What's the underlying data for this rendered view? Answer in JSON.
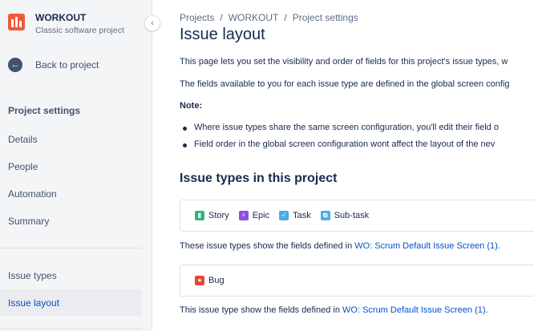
{
  "project": {
    "name": "WORKOUT",
    "type": "Classic software project",
    "logo_color": "#ef5a3a"
  },
  "sidebar": {
    "back_label": "Back to project",
    "section_title": "Project settings",
    "items": [
      {
        "label": "Details"
      },
      {
        "label": "People"
      },
      {
        "label": "Automation"
      },
      {
        "label": "Summary"
      }
    ],
    "items_lower": [
      {
        "label": "Issue types"
      },
      {
        "label": "Issue layout"
      }
    ]
  },
  "breadcrumb": [
    "Projects",
    "WORKOUT",
    "Project settings"
  ],
  "page": {
    "title": "Issue layout",
    "intro1": "This page lets you set the visibility and order of fields for this project's issue types, w",
    "intro2": "The fields available to you for each issue type are defined in the global screen config",
    "note_label": "Note:",
    "bullets": [
      "Where issue types share the same screen configuration, you'll edit their field o",
      "Field order in the global screen configuration wont affect the layout of the nev"
    ],
    "section_title": "Issue types in this project"
  },
  "groups": [
    {
      "types": [
        {
          "name": "Story",
          "icon": "story-icon",
          "color": "#36b37e"
        },
        {
          "name": "Epic",
          "icon": "epic-icon",
          "color": "#904ee2"
        },
        {
          "name": "Task",
          "icon": "task-icon",
          "color": "#4bade8"
        },
        {
          "name": "Sub-task",
          "icon": "subtask-icon",
          "color": "#4bade8"
        }
      ],
      "explain_prefix": "These issue types show the fields defined in ",
      "link": "WO: Scrum Default Issue Screen (1)",
      "explain_suffix": "."
    },
    {
      "types": [
        {
          "name": "Bug",
          "icon": "bug-icon",
          "color": "#e5493a"
        }
      ],
      "explain_prefix": "This issue type show the fields defined in ",
      "link": "WO: Scrum Default Issue Screen (1)",
      "explain_suffix": "."
    }
  ],
  "colors": {
    "link": "#0052cc",
    "active_nav": "#0052cc",
    "sidebar_bg": "#f4f5f7"
  }
}
